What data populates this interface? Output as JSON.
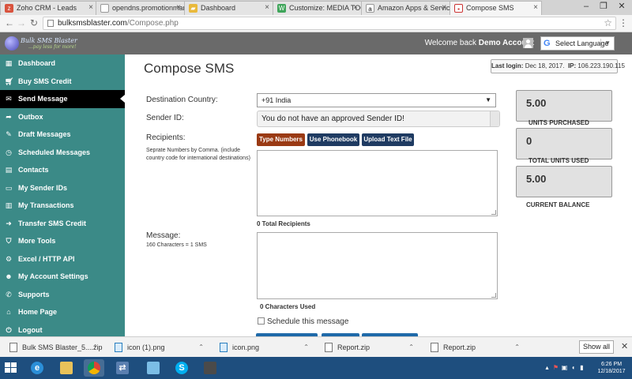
{
  "browser": {
    "tabs": [
      {
        "label": "Zoho CRM - Leads",
        "favicon": "zoho-icon",
        "active": false
      },
      {
        "label": "opendns.promotionmarke",
        "favicon": "page-icon",
        "active": false
      },
      {
        "label": "Dashboard",
        "favicon": "dashboard-icon",
        "active": false
      },
      {
        "label": "Customize: MEDIA TOOL",
        "favicon": "wordpress-icon",
        "active": false
      },
      {
        "label": "Amazon Apps & Services",
        "favicon": "amazon-icon",
        "active": false
      },
      {
        "label": "Compose SMS",
        "favicon": "sms-icon",
        "active": true
      }
    ],
    "url_host": "bulksmsblaster.com",
    "url_path": "/Compose.php"
  },
  "header": {
    "brand": "Bulk SMS Blaster",
    "tagline": "...pay less for more!",
    "welcome_prefix": "Welcome back",
    "user_name": "Demo Account",
    "language_label": "Select Language"
  },
  "sidebar": {
    "items": [
      {
        "label": "Dashboard",
        "icon": "windows-icon",
        "active": false
      },
      {
        "label": "Buy SMS Credit",
        "icon": "cart-icon",
        "active": false
      },
      {
        "label": "Send Message",
        "icon": "envelope-icon",
        "active": true
      },
      {
        "label": "Outbox",
        "icon": "send-icon",
        "active": false
      },
      {
        "label": "Draft Messages",
        "icon": "drafts-icon",
        "active": false
      },
      {
        "label": "Scheduled Messages",
        "icon": "clock-icon",
        "active": false
      },
      {
        "label": "Contacts",
        "icon": "contacts-icon",
        "active": false
      },
      {
        "label": "My Sender IDs",
        "icon": "id-card-icon",
        "active": false
      },
      {
        "label": "My Transactions",
        "icon": "transactions-icon",
        "active": false
      },
      {
        "label": "Transfer SMS Credit",
        "icon": "transfer-icon",
        "active": false
      },
      {
        "label": "More Tools",
        "icon": "shield-icon",
        "active": false
      },
      {
        "label": "Excel / HTTP API",
        "icon": "api-icon",
        "active": false
      },
      {
        "label": "My Account Settings",
        "icon": "user-icon",
        "active": false
      },
      {
        "label": "Supports",
        "icon": "support-icon",
        "active": false
      },
      {
        "label": "Home Page",
        "icon": "home-icon",
        "active": false
      },
      {
        "label": "Logout",
        "icon": "power-icon",
        "active": false
      }
    ]
  },
  "main": {
    "title": "Compose SMS",
    "last_login_label": "Last login:",
    "last_login_date": "Dec 18, 2017.",
    "ip_label": "IP:",
    "ip": "106.223.190.115",
    "destination_label": "Destination Country:",
    "destination_value": "+91 India",
    "sender_label": "Sender ID:",
    "sender_value": "You do not have an approved Sender ID!",
    "recipients_label": "Recipients:",
    "recipients_help": "Seprate Numbers by Comma. (include country code for international destinations)",
    "buttons": {
      "type_numbers": "Type Numbers",
      "phonebook": "Use Phonebook",
      "text_file": "Upload Text File"
    },
    "recipients_count": "0 Total Recipients",
    "message_label": "Message:",
    "message_help": "160 Characters = 1 SMS",
    "characters_used": "0 Characters Used",
    "schedule_label": "Schedule this message"
  },
  "stats": [
    {
      "value": "5.00",
      "label": "UNITS PURCHASED"
    },
    {
      "value": "0",
      "label": "TOTAL UNITS USED"
    },
    {
      "value": "5.00",
      "label": "CURRENT BALANCE"
    }
  ],
  "downloads": {
    "items": [
      {
        "name": "Bulk SMS Blaster_5....zip",
        "icon": "zip-file-icon"
      },
      {
        "name": "icon (1).png",
        "icon": "image-file-icon"
      },
      {
        "name": "icon.png",
        "icon": "image-file-icon"
      },
      {
        "name": "Report.zip",
        "icon": "zip-file-icon"
      },
      {
        "name": "Report.zip",
        "icon": "zip-file-icon"
      }
    ],
    "show_all": "Show all"
  },
  "taskbar": {
    "time": "6:26 PM",
    "date": "12/18/2017"
  },
  "colors": {
    "sidebar": "#3b8a87",
    "header": "#6a6a6a",
    "active_nav": "#000000",
    "button_primary": "#9a3a14",
    "button_secondary": "#1f3b62",
    "taskbar": "#1e4e7e"
  }
}
